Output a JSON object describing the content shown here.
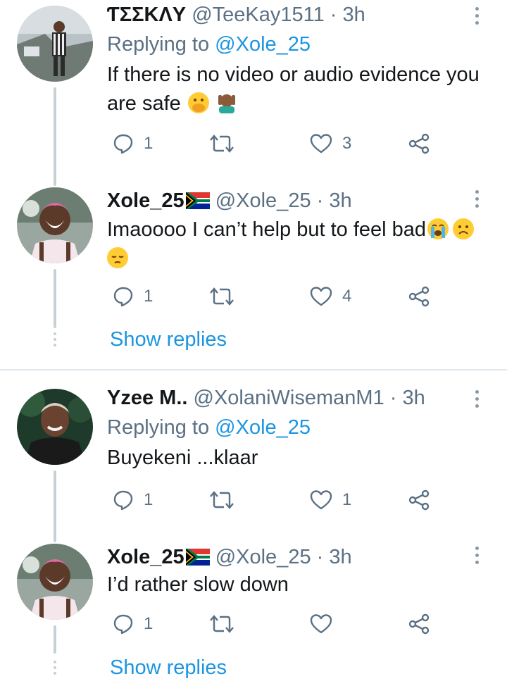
{
  "tweets": [
    {
      "name": "ƬΣΣKΛY",
      "handle": "@TeeKay1511",
      "sep": " · ",
      "time": "3h",
      "replying_prefix": "Replying to ",
      "replying_to": "@Xole_25",
      "text": "If there is no video or audio evidence you are safe",
      "emojis": [
        "hand-over-mouth-emoji",
        "facepalm-emoji"
      ],
      "replies": "1",
      "retweets": "",
      "likes": "3"
    },
    {
      "name": "Xole_25",
      "flag": "south-africa-flag",
      "handle": "@Xole_25",
      "sep": " · ",
      "time": "3h",
      "text": "Imaoooo I can’t help but to feel bad",
      "emojis": [
        "crying-face-emoji",
        "frowning-face-emoji",
        "pensive-face-emoji"
      ],
      "replies": "1",
      "retweets": "",
      "likes": "4",
      "show_replies": "Show replies"
    },
    {
      "name": "Yzee M..",
      "handle": "@XolaniWisemanM1",
      "sep": " · ",
      "time": "3h",
      "replying_prefix": "Replying to ",
      "replying_to": "@Xole_25",
      "text": "Buyekeni ...klaar",
      "replies": "1",
      "retweets": "",
      "likes": "1"
    },
    {
      "name": "Xole_25",
      "flag": "south-africa-flag",
      "handle": "@Xole_25",
      "sep": " · ",
      "time": "3h",
      "text": "I’d rather slow down",
      "replies": "1",
      "retweets": "",
      "likes": "",
      "show_replies": "Show replies"
    }
  ],
  "colors": {
    "link": "#1b95e0",
    "secondary_text": "#5b7083",
    "icon": "#5b7083",
    "thread_line": "#c8d0d6",
    "divider": "#e1e8ed"
  }
}
